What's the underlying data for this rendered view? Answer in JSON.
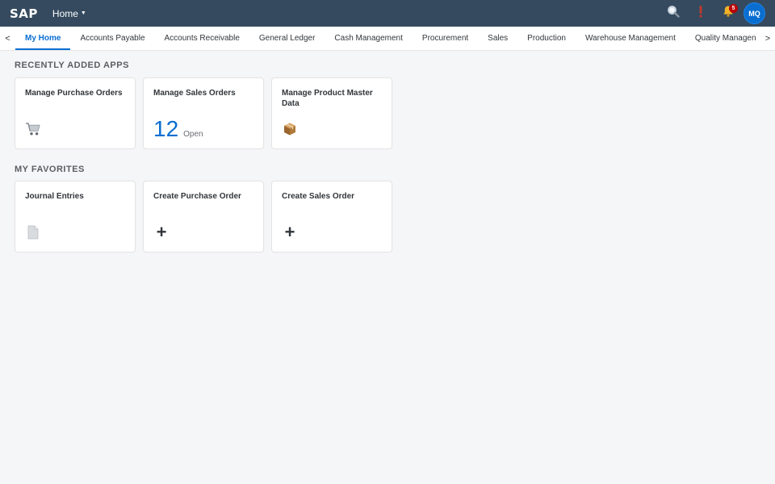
{
  "shell": {
    "logo": "SAP",
    "home_label": "Home",
    "notification_count": "5",
    "avatar_initials": "MQ",
    "icons": [
      "search-icon",
      "help-icon",
      "bell-icon"
    ]
  },
  "tabs": {
    "prev_arrow": "<",
    "next_arrow": ">",
    "items": [
      {
        "label": "My Home",
        "active": true
      },
      {
        "label": "Accounts Payable"
      },
      {
        "label": "Accounts Receivable"
      },
      {
        "label": "General Ledger"
      },
      {
        "label": "Cash Management"
      },
      {
        "label": "Procurement"
      },
      {
        "label": "Sales"
      },
      {
        "label": "Production"
      },
      {
        "label": "Warehouse Management"
      },
      {
        "label": "Quality Managen"
      }
    ]
  },
  "recent": {
    "title": "RECENTLY ADDED APPS",
    "tiles": [
      {
        "title": "Manage Purchase Orders",
        "icon": "cart-icon"
      },
      {
        "title": "Manage Sales Orders",
        "kpi_value": "12",
        "kpi_unit": "Open"
      },
      {
        "title": "Manage Product Master Data",
        "icon": "package-icon"
      }
    ]
  },
  "favorites": {
    "title": "MY FAVORITES",
    "tiles": [
      {
        "title": "Journal Entries",
        "icon": "document-icon"
      },
      {
        "title": "Create Purchase Order",
        "icon": "plus-icon",
        "glyph": "+"
      },
      {
        "title": "Create Sales Order",
        "icon": "plus-icon",
        "glyph": "+"
      }
    ]
  },
  "colors": {
    "shell_bg": "#354a5f",
    "accent": "#0a6ed1",
    "badge": "#bb0000",
    "page_bg": "#f5f6f7"
  }
}
